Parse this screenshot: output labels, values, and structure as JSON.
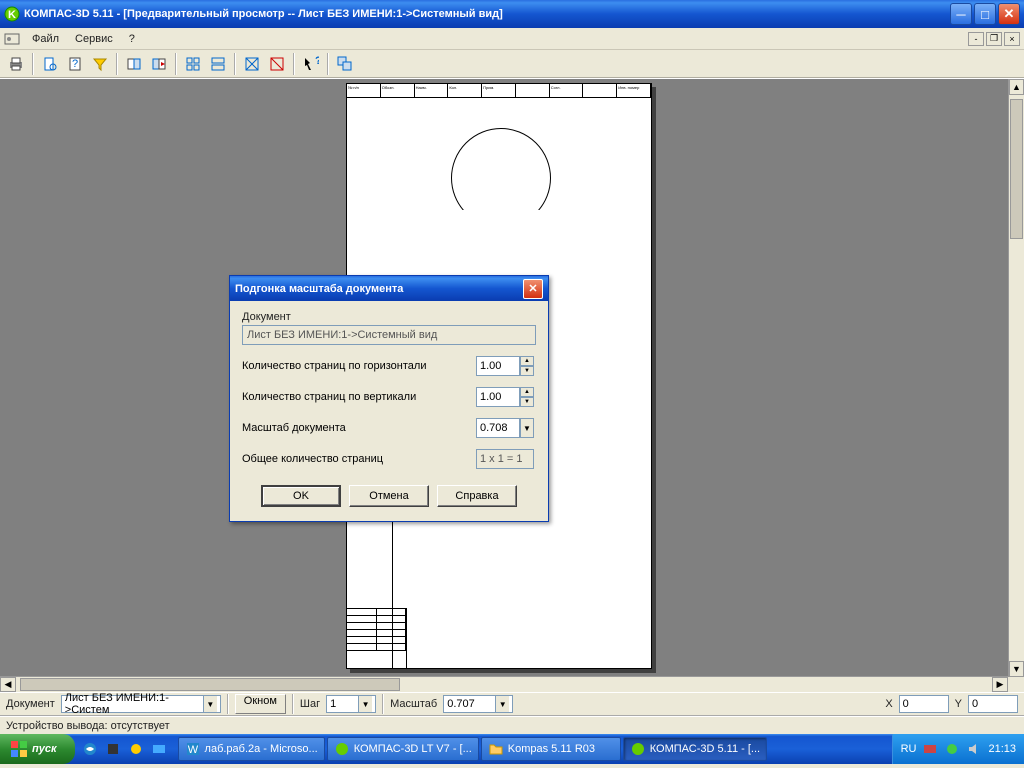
{
  "window": {
    "title": "КОМПАС-3D 5.11 - [Предварительный просмотр -- Лист БЕЗ ИМЕНИ:1->Системный вид]"
  },
  "menu": {
    "items": [
      "Файл",
      "Сервис",
      "?"
    ]
  },
  "toolbar_icons": [
    "print",
    "zoom-doc",
    "doc-info",
    "filter",
    "page-next",
    "page-close",
    "grid-3",
    "grid-4",
    "grid-x",
    "grid-red",
    "help-arrow",
    "tile-window"
  ],
  "paper_header_cells": [
    "№ п/п",
    "Обозн.",
    "Наим.",
    "Кол.",
    "Прим.",
    "",
    "Согл.",
    "",
    "Инв. номер"
  ],
  "dialog": {
    "title": "Подгонка масштаба документа",
    "doc_label": "Документ",
    "doc_value": "Лист БЕЗ ИМЕНИ:1->Системный вид",
    "rows": {
      "h_pages_label": "Количество страниц по горизонтали",
      "h_pages_value": "1.00",
      "v_pages_label": "Количество страниц по вертикали",
      "v_pages_value": "1.00",
      "scale_label": "Масштаб документа",
      "scale_value": "0.708",
      "total_label": "Общее количество страниц",
      "total_value": "1 x 1 = 1"
    },
    "buttons": {
      "ok": "OK",
      "cancel": "Отмена",
      "help": "Справка"
    }
  },
  "bottombar": {
    "doc_label": "Документ",
    "doc_value": "Лист БЕЗ ИМЕНИ:1->Систем",
    "window_btn": "Окном",
    "step_label": "Шаг",
    "step_value": "1",
    "scale_label": "Масштаб",
    "scale_value": "0.707",
    "x_label": "X",
    "x_value": "0",
    "y_label": "Y",
    "y_value": "0"
  },
  "status": {
    "text": "Устройство вывода: отсутствует"
  },
  "taskbar": {
    "start": "пуск",
    "tasks": [
      {
        "label": "лаб.раб.2а - Microso...",
        "icon": "word-icon"
      },
      {
        "label": "КОМПАС-3D LT V7 - [...",
        "icon": "kompas-icon"
      },
      {
        "label": "Kompas 5.11 R03",
        "icon": "folder-icon"
      },
      {
        "label": "КОМПАС-3D 5.11 - [...",
        "icon": "kompas-icon",
        "active": true
      }
    ],
    "lang": "RU",
    "time": "21:13"
  }
}
